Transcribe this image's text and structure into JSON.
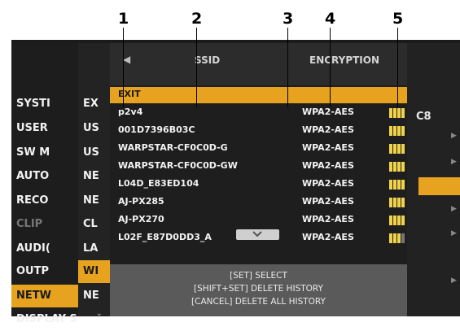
{
  "callouts": [
    "1",
    "2",
    "3",
    "4",
    "5"
  ],
  "main_menu": {
    "items": [
      {
        "label": "SYSTI",
        "state": "normal"
      },
      {
        "label": "USER",
        "state": "normal"
      },
      {
        "label": "SW M",
        "state": "normal"
      },
      {
        "label": "AUTO",
        "state": "normal"
      },
      {
        "label": "RECO",
        "state": "normal"
      },
      {
        "label": "CLIP",
        "state": "dim"
      },
      {
        "label": "AUDI(",
        "state": "normal"
      },
      {
        "label": "OUTP",
        "state": "normal"
      },
      {
        "label": "NETW",
        "state": "selected"
      },
      {
        "label": "DISPLAY S",
        "state": "normal"
      }
    ]
  },
  "sub_menu": {
    "items": [
      {
        "label": "EX",
        "state": "normal"
      },
      {
        "label": "US",
        "state": "normal"
      },
      {
        "label": "US",
        "state": "normal"
      },
      {
        "label": "NE",
        "state": "normal"
      },
      {
        "label": "NE",
        "state": "normal"
      },
      {
        "label": "CL",
        "state": "normal"
      },
      {
        "label": "LA",
        "state": "normal"
      },
      {
        "label": "WI",
        "state": "selected"
      },
      {
        "label": "NE",
        "state": "normal"
      }
    ]
  },
  "right_panel": {
    "text": "C8"
  },
  "dialog": {
    "header": {
      "ssid": "SSID",
      "encryption": "ENCRYPTION"
    },
    "exit_label": "EXIT",
    "networks": [
      {
        "ssid": "p2v4",
        "encryption": "WPA2-AES",
        "signal_bars": 4
      },
      {
        "ssid": "001D7396B03C",
        "encryption": "WPA2-AES",
        "signal_bars": 4
      },
      {
        "ssid": "WARPSTAR-CF0C0D-G",
        "encryption": "WPA2-AES",
        "signal_bars": 4
      },
      {
        "ssid": "WARPSTAR-CF0C0D-GW",
        "encryption": "WPA2-AES",
        "signal_bars": 4
      },
      {
        "ssid": "L04D_E83ED104",
        "encryption": "WPA2-AES",
        "signal_bars": 4
      },
      {
        "ssid": "AJ-PX285",
        "encryption": "WPA2-AES",
        "signal_bars": 4
      },
      {
        "ssid": "AJ-PX270",
        "encryption": "WPA2-AES",
        "signal_bars": 4
      },
      {
        "ssid": "L02F_E87D0DD3_A",
        "encryption": "WPA2-AES",
        "signal_bars": 3
      }
    ],
    "help": [
      "[SET] SELECT",
      "[SHIFT+SET] DELETE HISTORY",
      "[CANCEL] DELETE ALL HISTORY"
    ]
  },
  "colors": {
    "selection": "#e7a320",
    "signal_on": "#f0d34a",
    "signal_off": "#777777"
  }
}
